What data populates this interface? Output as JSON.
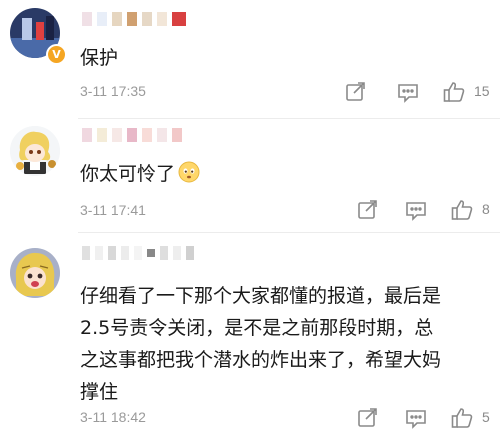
{
  "comments": [
    {
      "text": "保护",
      "time": "3-11 17:35",
      "likes": "15",
      "icons": {
        "share": "share-icon",
        "reply": "comment-icon",
        "like": "thumbs-up-icon",
        "verified": "verified-badge-icon"
      }
    },
    {
      "text": "你太可怜了",
      "time": "3-11 17:41",
      "likes": "8",
      "emoji": "sad-face-emoji"
    },
    {
      "text_lines": [
        "仔细看了一下那个大家都懂的报道，最后是",
        "2.5号责令关闭，是不是之前那段时期，总",
        "之这事都把我个潜水的炸出来了，希望大妈",
        "撑住"
      ],
      "time": "3-11 18:42",
      "likes": "5"
    }
  ],
  "colors": {
    "verified_badge": "#f5a623",
    "meta_text": "#9a9a9a",
    "icon": "#8a8a8a"
  }
}
